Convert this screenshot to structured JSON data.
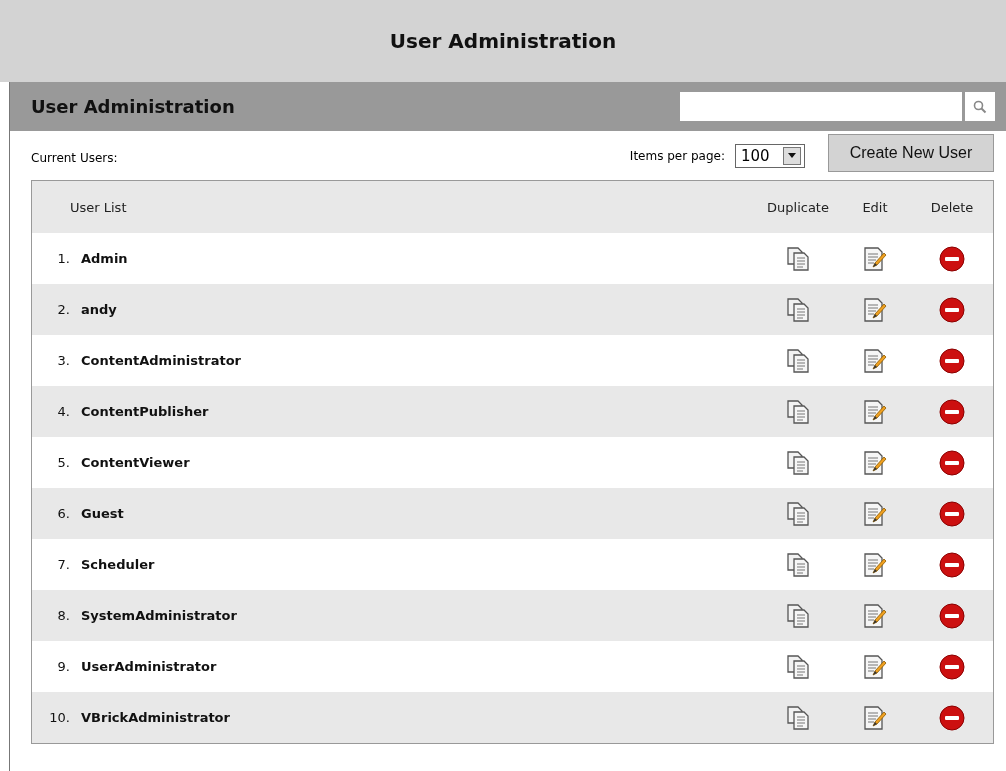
{
  "page": {
    "title": "User Administration"
  },
  "section": {
    "title": "User Administration"
  },
  "toolbar": {
    "label": "Current Users:",
    "items_per_page": {
      "label": "Items per page:",
      "value": "100"
    },
    "create_button": "Create New User"
  },
  "table": {
    "columns": [
      "User List",
      "Duplicate",
      "Edit",
      "Delete"
    ],
    "rows": [
      {
        "number": "1.",
        "name": "Admin"
      },
      {
        "number": "2.",
        "name": "andy"
      },
      {
        "number": "3.",
        "name": "ContentAdministrator"
      },
      {
        "number": "4.",
        "name": "ContentPublisher"
      },
      {
        "number": "5.",
        "name": "ContentViewer"
      },
      {
        "number": "6.",
        "name": "Guest"
      },
      {
        "number": "7.",
        "name": "Scheduler"
      },
      {
        "number": "8.",
        "name": "SystemAdministrator"
      },
      {
        "number": "9.",
        "name": "UserAdministrator"
      },
      {
        "number": "10.",
        "name": "VBrickAdministrator"
      }
    ]
  }
}
